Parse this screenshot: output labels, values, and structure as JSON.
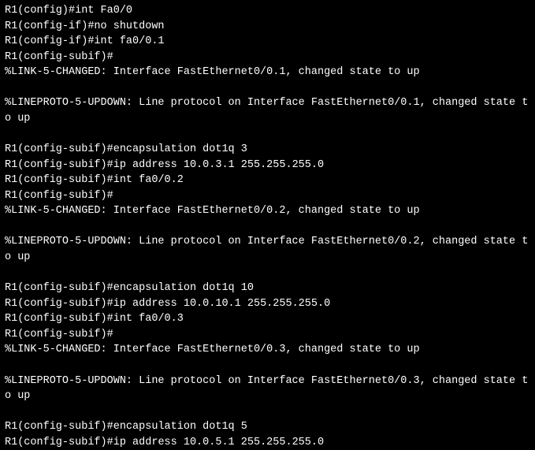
{
  "terminal": {
    "lines": [
      {
        "prompt": "R1(config)#",
        "cmd": "int Fa0/0"
      },
      {
        "prompt": "R1(config-if)#",
        "cmd": "no shutdown"
      },
      {
        "prompt": "R1(config-if)#",
        "cmd": "int fa0/0.1"
      },
      {
        "prompt": "R1(config-subif)#",
        "cmd": ""
      },
      {
        "text": "%LINK-5-CHANGED: Interface FastEthernet0/0.1, changed state to up"
      },
      {
        "text": ""
      },
      {
        "text": "%LINEPROTO-5-UPDOWN: Line protocol on Interface FastEthernet0/0.1, changed state to up"
      },
      {
        "text": ""
      },
      {
        "prompt": "R1(config-subif)#",
        "cmd": "encapsulation dot1q 3"
      },
      {
        "prompt": "R1(config-subif)#",
        "cmd": "ip address 10.0.3.1 255.255.255.0"
      },
      {
        "prompt": "R1(config-subif)#",
        "cmd": "int fa0/0.2"
      },
      {
        "prompt": "R1(config-subif)#",
        "cmd": ""
      },
      {
        "text": "%LINK-5-CHANGED: Interface FastEthernet0/0.2, changed state to up"
      },
      {
        "text": ""
      },
      {
        "text": "%LINEPROTO-5-UPDOWN: Line protocol on Interface FastEthernet0/0.2, changed state to up"
      },
      {
        "text": ""
      },
      {
        "prompt": "R1(config-subif)#",
        "cmd": "encapsulation dot1q 10"
      },
      {
        "prompt": "R1(config-subif)#",
        "cmd": "ip address 10.0.10.1 255.255.255.0"
      },
      {
        "prompt": "R1(config-subif)#",
        "cmd": "int fa0/0.3"
      },
      {
        "prompt": "R1(config-subif)#",
        "cmd": ""
      },
      {
        "text": "%LINK-5-CHANGED: Interface FastEthernet0/0.3, changed state to up"
      },
      {
        "text": ""
      },
      {
        "text": "%LINEPROTO-5-UPDOWN: Line protocol on Interface FastEthernet0/0.3, changed state to up"
      },
      {
        "text": ""
      },
      {
        "prompt": "R1(config-subif)#",
        "cmd": "encapsulation dot1q 5"
      },
      {
        "prompt": "R1(config-subif)#",
        "cmd": "ip address 10.0.5.1 255.255.255.0"
      }
    ]
  }
}
